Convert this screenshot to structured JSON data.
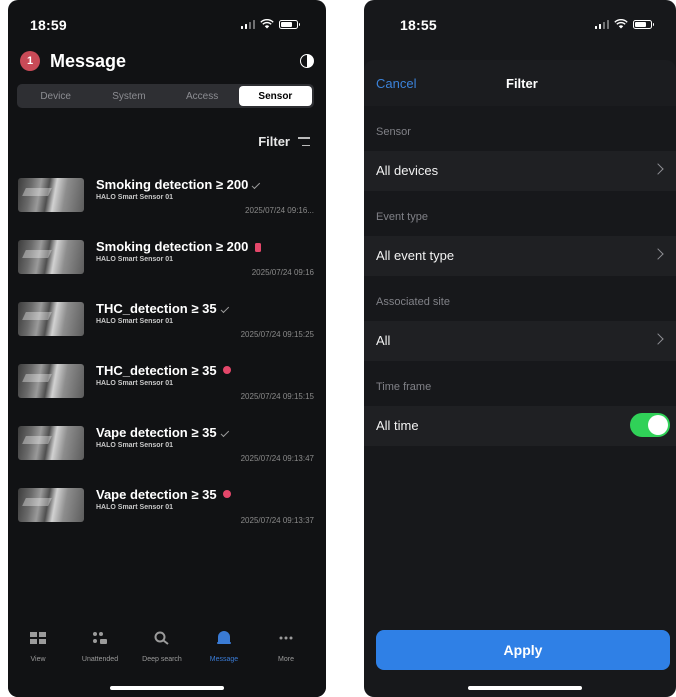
{
  "left_screen": {
    "status_time": "18:59",
    "header": {
      "badge": "1",
      "title": "Message"
    },
    "segments": [
      {
        "label": "Device",
        "active": false
      },
      {
        "label": "System",
        "active": false
      },
      {
        "label": "Access",
        "active": false
      },
      {
        "label": "Sensor",
        "active": true
      }
    ],
    "filter_label": "Filter",
    "messages": [
      {
        "title": "Smoking detection ≥ 200",
        "sensor": "HALO Smart Sensor 01",
        "time": "2025/07/24 09:16...",
        "status_icon": "check-icon"
      },
      {
        "title": "Smoking detection ≥ 200",
        "sensor": "HALO Smart Sensor 01",
        "time": "2025/07/24 09:16",
        "status_icon": "unread-indicator-icon"
      },
      {
        "title": "THC_detection ≥ 35",
        "sensor": "HALO Smart Sensor 01",
        "time": "2025/07/24 09:15:25",
        "status_icon": "check-icon"
      },
      {
        "title": "THC_detection ≥ 35",
        "sensor": "HALO Smart Sensor 01",
        "time": "2025/07/24 09:15:15",
        "status_icon": "unread-dot-icon"
      },
      {
        "title": "Vape detection ≥ 35",
        "sensor": "HALO Smart Sensor 01",
        "time": "2025/07/24 09:13:47",
        "status_icon": "check-icon"
      },
      {
        "title": "Vape detection ≥ 35",
        "sensor": "HALO Smart Sensor 01",
        "time": "2025/07/24 09:13:37",
        "status_icon": "unread-dot-icon"
      }
    ],
    "tabs": [
      {
        "label": "View",
        "icon": "grid-view-icon",
        "active": false
      },
      {
        "label": "Unattended",
        "icon": "unattended-icon",
        "active": false
      },
      {
        "label": "Deep search",
        "icon": "deep-search-icon",
        "active": false
      },
      {
        "label": "Message",
        "icon": "message-icon",
        "active": true
      },
      {
        "label": "More",
        "icon": "more-icon",
        "active": false
      }
    ]
  },
  "right_screen": {
    "status_time": "18:55",
    "nav": {
      "cancel": "Cancel",
      "title": "Filter"
    },
    "sections": [
      {
        "label": "Sensor",
        "value": "All devices",
        "control": "chevron"
      },
      {
        "label": "Event type",
        "value": "All event type",
        "control": "chevron"
      },
      {
        "label": "Associated site",
        "value": "All",
        "control": "chevron"
      },
      {
        "label": "Time frame",
        "value": "All time",
        "control": "toggle",
        "toggle_on": true
      }
    ],
    "apply_label": "Apply"
  },
  "colors": {
    "accent_blue": "#2f80e6",
    "alert_pink": "#e4476a",
    "toggle_green": "#30d158",
    "badge_red": "#c94a57"
  }
}
